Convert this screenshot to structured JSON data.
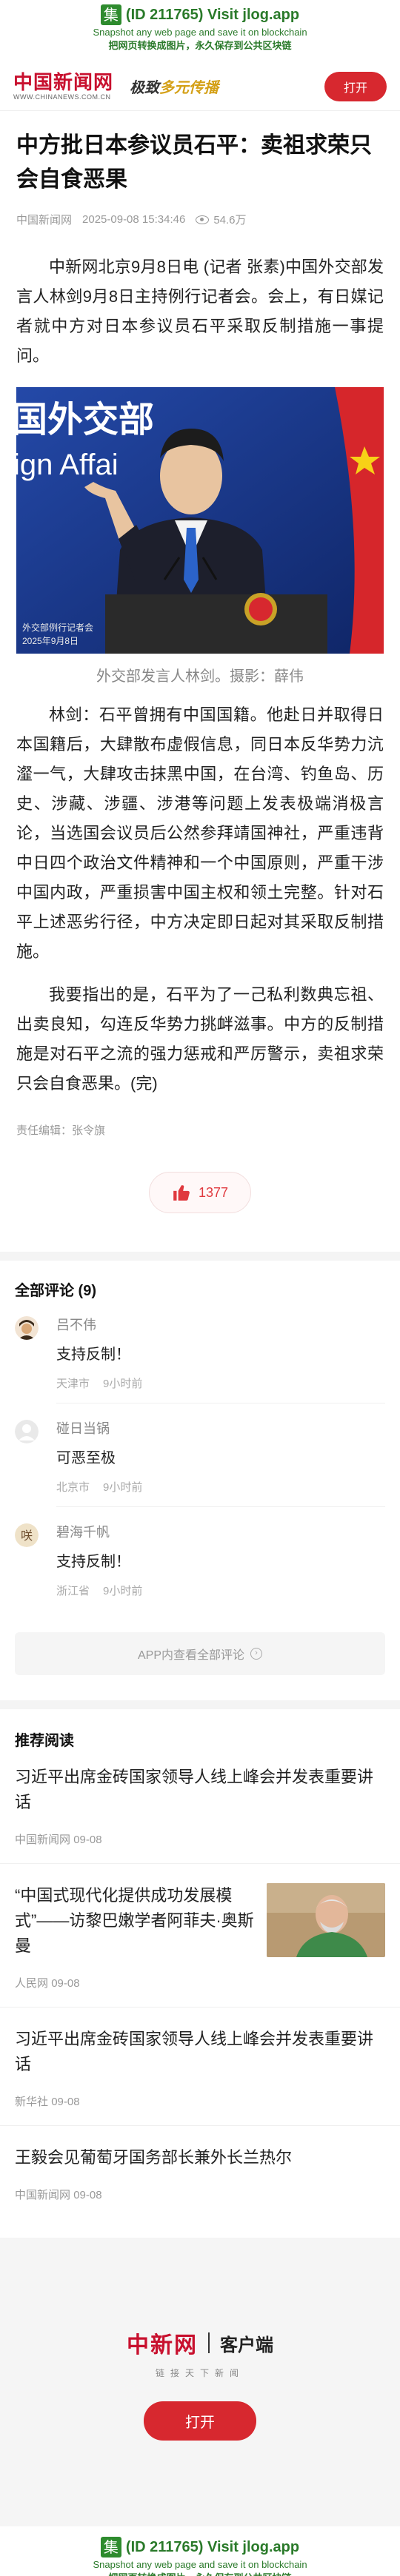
{
  "jlog": {
    "badge": "集",
    "title": "(ID 211765) Visit jlog.app",
    "sub1": "Snapshot any web page and save it on blockchain",
    "sub2": "把网页转换成图片，永久保存到公共区块链"
  },
  "header": {
    "logo": "中国新闻网",
    "url": "WWW.CHINANEWS.COM.CN",
    "slogan_prefix": "极致",
    "slogan_main": "多元传播",
    "open_button": "打开"
  },
  "article": {
    "title": "中方批日本参议员石平：卖祖求荣只会自食恶果",
    "source": "中国新闻网",
    "datetime": "2025-09-08 15:34:46",
    "views": "54.6万",
    "para1": "中新网北京9月8日电 (记者 张素)中国外交部发言人林剑9月8日主持例行记者会。会上，有日媒记者就中方对日本参议员石平采取反制措施一事提问。",
    "photo_overlay_line1": "外交部例行记者会",
    "photo_overlay_line2": "2025年9月8日",
    "photo_wall_text": "国外交部",
    "photo_wall_text2": "ign Affai",
    "caption": "外交部发言人林剑。摄影：薛伟",
    "para2": "林剑：石平曾拥有中国国籍。他赴日并取得日本国籍后，大肆散布虚假信息，同日本反华势力沆瀣一气，大肆攻击抹黑中国，在台湾、钓鱼岛、历史、涉藏、涉疆、涉港等问题上发表极端消极言论，当选国会议员后公然参拜靖国神社，严重违背中日四个政治文件精神和一个中国原则，严重干涉中国内政，严重损害中国主权和领土完整。针对石平上述恶劣行径，中方决定即日起对其采取反制措施。",
    "para3": "我要指出的是，石平为了一己私利数典忘祖、出卖良知，勾连反华势力挑衅滋事。中方的反制措施是对石平之流的强力惩戒和严厉警示，卖祖求荣只会自食恶果。(完)",
    "editor": "责任编辑：张令旗",
    "likes": "1377"
  },
  "comments": {
    "title": "全部评论 (9)",
    "items": [
      {
        "name": "吕不伟",
        "text": "支持反制！",
        "location": "天津市",
        "time": "9小时前"
      },
      {
        "name": "碰日当锅",
        "text": "可恶至极",
        "location": "北京市",
        "time": "9小时前"
      },
      {
        "name": "碧海千帆",
        "text": "支持反制！",
        "location": "浙江省",
        "time": "9小时前"
      }
    ],
    "app_more": "APP内查看全部评论"
  },
  "recommend": {
    "title": "推荐阅读",
    "items": [
      {
        "headline": "习近平出席金砖国家领导人线上峰会并发表重要讲话",
        "source": "中国新闻网",
        "date": "09-08"
      },
      {
        "headline": "“中国式现代化提供成功发展模式”——访黎巴嫩学者阿菲夫·奥斯曼",
        "source": "人民网",
        "date": "09-08"
      },
      {
        "headline": "习近平出席金砖国家领导人线上峰会并发表重要讲话",
        "source": "新华社",
        "date": "09-08"
      },
      {
        "headline": "王毅会见葡萄牙国务部长兼外长兰热尔",
        "source": "中国新闻网",
        "date": "09-08"
      }
    ]
  },
  "bottom_app": {
    "logo": "中新网",
    "client": "客户端",
    "sub": "链接天下新闻",
    "button": "打开"
  },
  "colors": {
    "brand_red": "#d7282f",
    "jlog_green": "#2a7a2a"
  }
}
